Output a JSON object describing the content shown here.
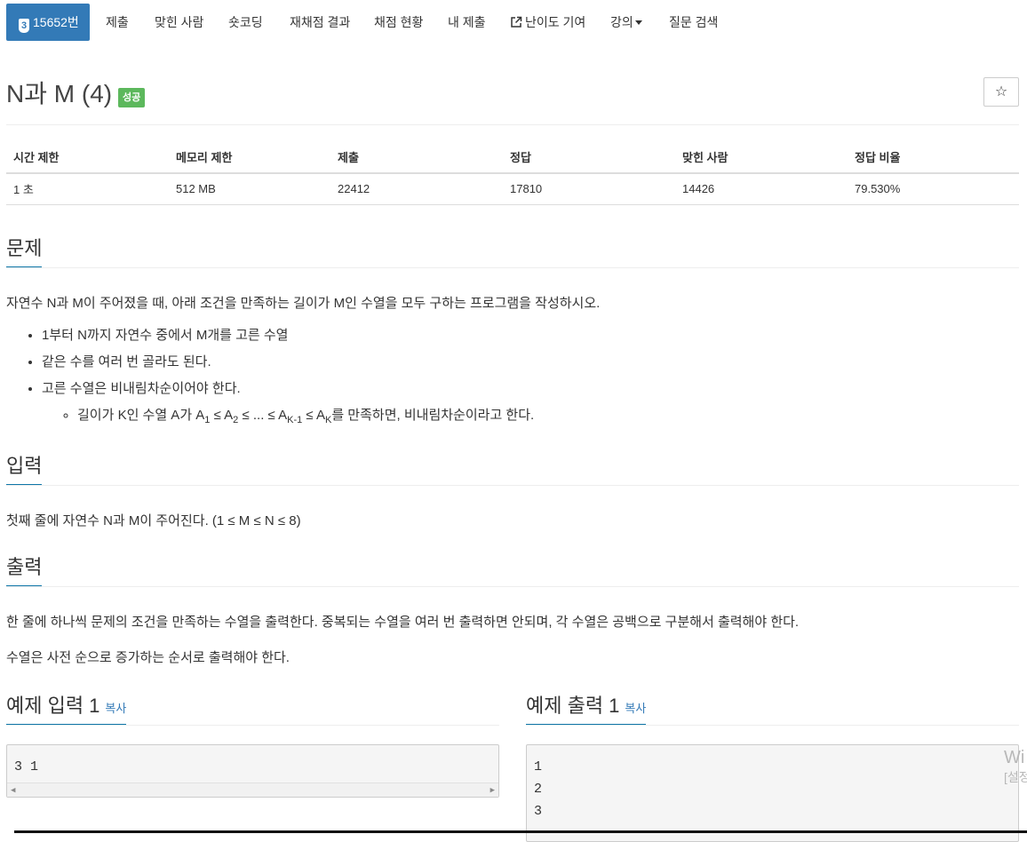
{
  "nav": {
    "tier": "3",
    "problem_id": "15652번",
    "items": [
      "제출",
      "맞힌 사람",
      "숏코딩",
      "재채점 결과",
      "채점 현황",
      "내 제출",
      "난이도 기여",
      "강의",
      "질문 검색"
    ]
  },
  "problem": {
    "title": "N과 M (4)",
    "status": "성공",
    "star": "☆"
  },
  "info": {
    "headers": [
      "시간 제한",
      "메모리 제한",
      "제출",
      "정답",
      "맞힌 사람",
      "정답 비율"
    ],
    "values": [
      "1 초",
      "512 MB",
      "22412",
      "17810",
      "14426",
      "79.530%"
    ]
  },
  "sections": {
    "description_title": "문제",
    "description_text": "자연수 N과 M이 주어졌을 때, 아래 조건을 만족하는 길이가 M인 수열을 모두 구하는 프로그램을 작성하시오.",
    "bullets": [
      "1부터 N까지 자연수 중에서 M개를 고른 수열",
      "같은 수를 여러 번 골라도 된다.",
      "고른 수열은 비내림차순이어야 한다."
    ],
    "sub_bullet": {
      "prefix": "길이가 K인 수열 A가 A",
      "s1": "1",
      "le1": " ≤ A",
      "s2": "2",
      "mid": " ≤ ... ≤ A",
      "s3": "K-1",
      "le2": " ≤ A",
      "s4": "K",
      "suffix": "를 만족하면, 비내림차순이라고 한다."
    },
    "input_title": "입력",
    "input_text": "첫째 줄에 자연수 N과 M이 주어진다. (1 ≤ M ≤ N ≤ 8)",
    "output_title": "출력",
    "output_text1": "한 줄에 하나씩 문제의 조건을 만족하는 수열을 출력한다. 중복되는 수열을 여러 번 출력하면 안되며, 각 수열은 공백으로 구분해서 출력해야 한다.",
    "output_text2": "수열은 사전 순으로 증가하는 순서로 출력해야 한다."
  },
  "samples": {
    "input_title": "예제 입력 1",
    "output_title": "예제 출력 1",
    "copy_label": "복사",
    "input_text": "3 1",
    "output_text": "1\n2\n3"
  },
  "watermark": {
    "line1": "Wi",
    "line2": "[설정"
  },
  "colors": {
    "accent": "#337ab7",
    "success": "#5cb85c",
    "section_underline": "#0e76a8"
  }
}
